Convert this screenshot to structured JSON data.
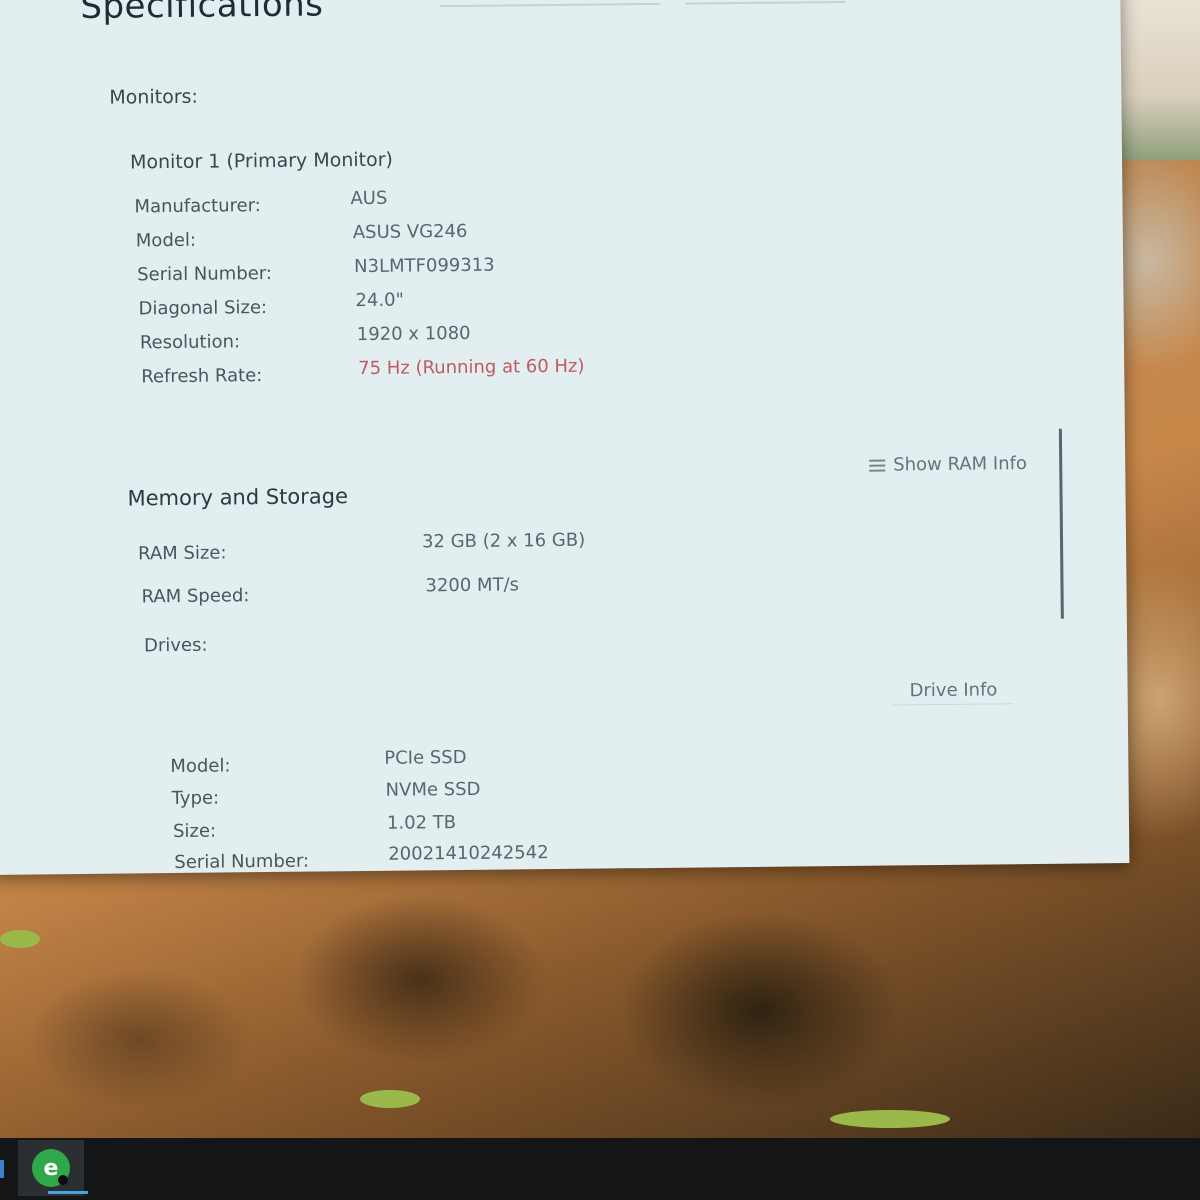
{
  "window": {
    "title": "Specifications"
  },
  "monitors": {
    "section_label": "Monitors:",
    "monitor_title": "Monitor 1 (Primary Monitor)",
    "rows": [
      {
        "label": "Manufacturer:",
        "value": "AUS"
      },
      {
        "label": "Model:",
        "value": "ASUS VG246"
      },
      {
        "label": "Serial Number:",
        "value": "N3LMTF099313"
      },
      {
        "label": "Diagonal Size:",
        "value": "24.0\""
      },
      {
        "label": "Resolution:",
        "value": "1920 x 1080"
      },
      {
        "label": "Refresh Rate:",
        "value": "75 Hz (Running at 60 Hz)"
      }
    ],
    "warning_color": "#c05a60"
  },
  "memory": {
    "heading": "Memory and Storage",
    "show_ram_info_label": "Show RAM Info",
    "rows": [
      {
        "label": "RAM Size:",
        "value": "32 GB (2 x 16 GB)"
      },
      {
        "label": "RAM Speed:",
        "value": "3200 MT/s"
      }
    ],
    "drives_label": "Drives:",
    "drive_info_label": "Drive Info",
    "drive_rows": [
      {
        "label": "Model:",
        "value": "PCIe SSD"
      },
      {
        "label": "Type:",
        "value": "NVMe SSD"
      },
      {
        "label": "Size:",
        "value": "1.02 TB"
      },
      {
        "label": "Serial Number:",
        "value": "20021410242542"
      }
    ]
  },
  "taskbar": {
    "app_icon": "app-green-circle-icon",
    "app_icon_glyph": "e"
  }
}
